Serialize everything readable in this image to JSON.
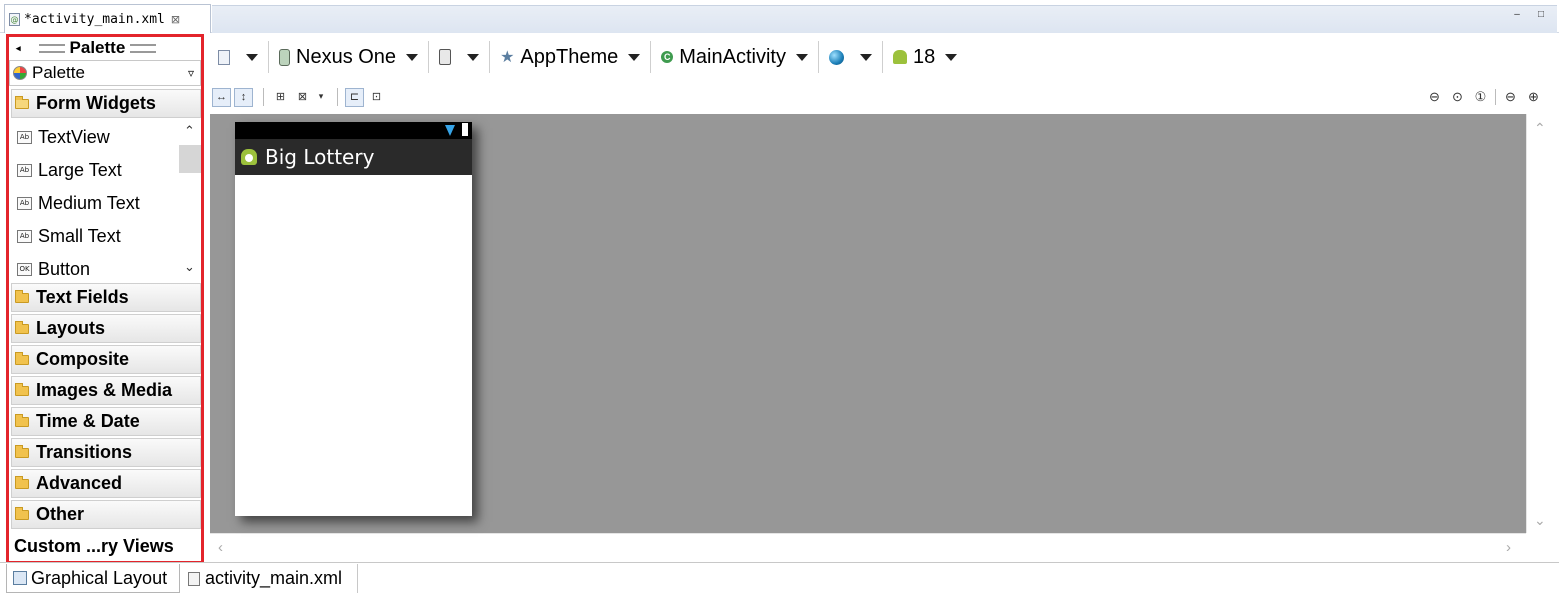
{
  "editor_tab": {
    "title": "*activity_main.xml",
    "close": "⊠"
  },
  "window_controls": {
    "minimize": "–",
    "maximize": "□"
  },
  "palette": {
    "header": "Palette",
    "collapse_arrow": "◂",
    "selector": "Palette",
    "selector_caret": "▿",
    "categories": [
      "Form Widgets",
      "Text Fields",
      "Layouts",
      "Composite",
      "Images & Media",
      "Time & Date",
      "Transitions",
      "Advanced",
      "Other"
    ],
    "widgets": [
      {
        "icon": "Ab",
        "label": "TextView"
      },
      {
        "icon": "Ab",
        "label": "Large Text"
      },
      {
        "icon": "Ab",
        "label": "Medium Text"
      },
      {
        "icon": "Ab",
        "label": "Small Text"
      },
      {
        "icon": "OK",
        "label": "Button"
      }
    ],
    "custom": "Custom ...ry Views",
    "scroll_up": "⌃",
    "scroll_down": "⌄"
  },
  "toolbar": {
    "device": "Nexus One",
    "theme": "AppTheme",
    "activity": "MainActivity",
    "api_level": "18",
    "star": "★",
    "activity_icon": "C"
  },
  "toolbar2": {
    "fit_width": "↔",
    "fit_height": "↕",
    "margins": "⊞",
    "distribute": "⊠",
    "dd": "▾",
    "layout1": "⊏",
    "layout2": "⊡"
  },
  "zoom": {
    "zoom_out_fit": "⊖",
    "zoom_actual": "⊙",
    "zoom_one": "①",
    "zoom_out": "⊖",
    "zoom_in": "⊕"
  },
  "device_preview": {
    "app_title": "Big Lottery"
  },
  "canvas_scroll": {
    "up": "⌃",
    "down": "⌄",
    "left": "‹",
    "right": "›"
  },
  "bottom_tabs": {
    "graphical": "Graphical Layout",
    "xml": "activity_main.xml"
  },
  "colors": {
    "palette_border": "#e3242b",
    "canvas_bg": "#979797",
    "actionbar": "#2a2a2a"
  }
}
